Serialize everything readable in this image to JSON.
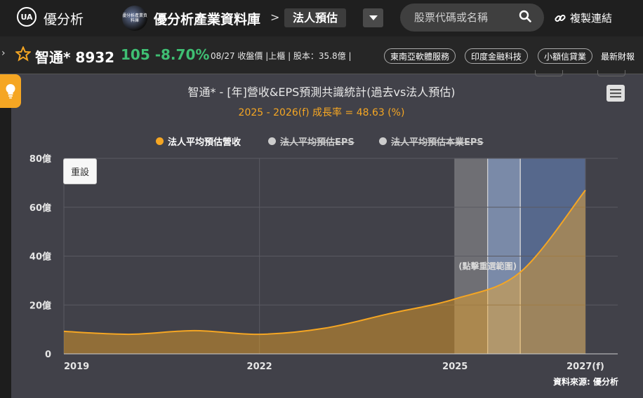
{
  "header": {
    "logo_text": "優分析",
    "logo_mark": "UA",
    "thumb_text": "優分析產業資料庫",
    "db_title": "優分析產業資料庫",
    "crumb_sep": ">",
    "crumb_current": "法人預估",
    "search_placeholder": "股票代碼或名稱",
    "copy_link": "複製連結"
  },
  "stock": {
    "name": "智通* 8932",
    "price_change": "105 -8.70%",
    "meta": "08/27 收盤價 |上櫃 | 股本：35.8億 |",
    "tags": [
      "東南亞軟體服務",
      "印度金融科技",
      "小額信貸業"
    ],
    "more": "最新財報"
  },
  "chart": {
    "reset_label": "重設",
    "source": "資料來源: 優分析"
  },
  "colors": {
    "accent": "#f5a623",
    "price_down": "#3fbf73",
    "panel": "#414149"
  },
  "chart_data": {
    "type": "area",
    "title": "智通* - [年]營收&EPS預測共識統計(過去vs法人預估)",
    "subtitle": "2025 - 2026(f) 成長率 = 48.63 (%)",
    "x": [
      2019,
      2020,
      2021,
      2022,
      2023,
      2024,
      2025,
      2026,
      2027
    ],
    "x_tick_labels": [
      "2019",
      "2022",
      "2025",
      "2027(f)"
    ],
    "x_tick_values": [
      2019,
      2022,
      2025,
      2027
    ],
    "y_tick_labels": [
      "0",
      "20億",
      "40億",
      "60億",
      "80億"
    ],
    "y_tick_values": [
      0,
      20,
      40,
      60,
      80
    ],
    "ylim": [
      0,
      80
    ],
    "xlim": [
      2019,
      2027
    ],
    "legend_placement": "top-center",
    "grid": true,
    "series": [
      {
        "name": "法人平均預估營收",
        "color": "#f5a623",
        "visible": true,
        "values": [
          9.2,
          8.0,
          9.5,
          8.0,
          10.5,
          16.5,
          22.5,
          33.4,
          67.0
        ]
      },
      {
        "name": "法人平均預估EPS",
        "color": "#cccccc",
        "visible": false,
        "values": []
      },
      {
        "name": "法人平均預估本業EPS",
        "color": "#cccccc",
        "visible": false,
        "values": []
      }
    ],
    "highlight_bands": [
      {
        "from": 2025,
        "to": 2025.5
      },
      {
        "from": 2025.5,
        "to": 2026
      },
      {
        "from": 2026,
        "to": 2027
      }
    ],
    "annotation": "(點擊重選範圍)"
  }
}
